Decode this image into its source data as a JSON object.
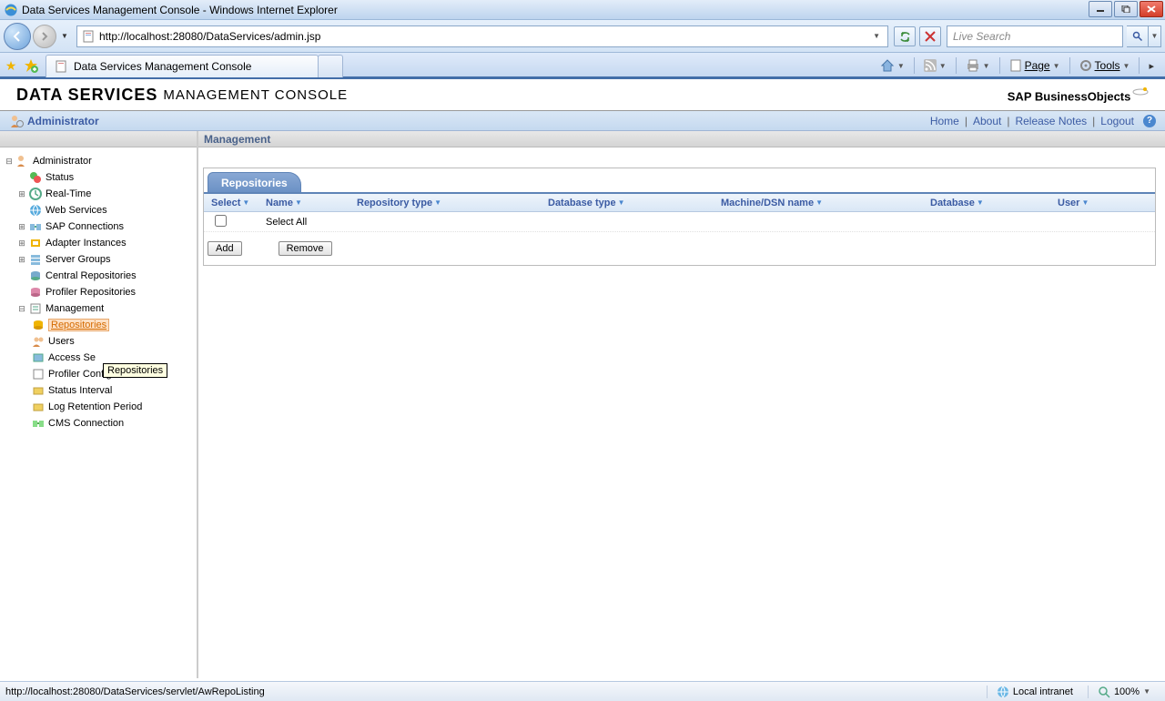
{
  "window": {
    "title": "Data Services Management Console - Windows Internet Explorer"
  },
  "address": {
    "url": "http://localhost:28080/DataServices/admin.jsp"
  },
  "search": {
    "placeholder": "Live Search"
  },
  "tab": {
    "title": "Data Services Management Console"
  },
  "ie_toolbar": {
    "page_label": "Page",
    "tools_label": "Tools"
  },
  "app": {
    "title_bold": "DATA SERVICES",
    "title_rest": "MANAGEMENT CONSOLE",
    "logo_prefix": "SAP Business",
    "logo_suffix": "Objects"
  },
  "admin_bar": {
    "label": "Administrator",
    "links": {
      "home": "Home",
      "about": "About",
      "release_notes": "Release Notes",
      "logout": "Logout"
    }
  },
  "breadcrumb": "Management",
  "subtab": {
    "label": "Repositories"
  },
  "grid": {
    "headers": {
      "select": "Select",
      "name": "Name",
      "repo_type": "Repository type",
      "db_type": "Database type",
      "machine": "Machine/DSN name",
      "database": "Database",
      "user": "User"
    },
    "select_all": "Select All",
    "buttons": {
      "add": "Add",
      "remove": "Remove"
    }
  },
  "tree": {
    "root": "Administrator",
    "status": "Status",
    "realtime": "Real-Time",
    "web_services": "Web Services",
    "sap_conn": "SAP Connections",
    "adapter": "Adapter Instances",
    "server_groups": "Server Groups",
    "central_repos": "Central Repositories",
    "profiler_repos": "Profiler Repositories",
    "management": "Management",
    "repositories": "Repositories",
    "users": "Users",
    "access_servers": "Access Se",
    "profiler_config": "Profiler Configuration",
    "status_interval": "Status Interval",
    "log_retention": "Log Retention Period",
    "cms_conn": "CMS Connection"
  },
  "tooltip": "Repositories",
  "status": {
    "url": "http://localhost:28080/DataServices/servlet/AwRepoListing",
    "zone": "Local intranet",
    "zoom": "100%"
  }
}
